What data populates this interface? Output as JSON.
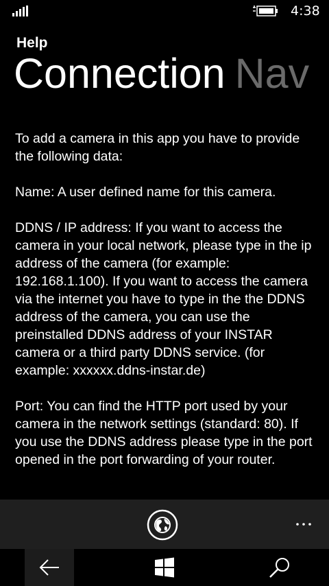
{
  "status_bar": {
    "time": "4:38",
    "signal_icon": "signal-strength-icon",
    "battery_icon": "battery-charging-icon"
  },
  "header": {
    "app_title": "Help",
    "pivot_items": [
      "Connection",
      "Nav"
    ]
  },
  "content": {
    "paragraphs": [
      "To add a camera in this app you have to provide the following data:",
      "Name: A user defined name for this camera.",
      "DDNS / IP address: If you want to access the camera in your local network, please type in the ip address of the camera (for example: 192.168.1.100). If you want to access the camera via the internet you have to type in the the DDNS address of the camera, you can use the preinstalled DDNS address of your INSTAR camera or a third party DDNS service. (for example: xxxxxx.ddns-instar.de)",
      "Port: You can find the HTTP port used by your camera in the network settings (standard: 80). If you use the DDNS address please type in the port opened in the port forwarding of your router."
    ]
  },
  "app_bar": {
    "primary_icon": "globe-icon",
    "more_icon": "more-ellipsis-icon"
  },
  "nav_bar": {
    "back_icon": "back-arrow-icon",
    "home_icon": "windows-logo-icon",
    "search_icon": "search-icon"
  }
}
